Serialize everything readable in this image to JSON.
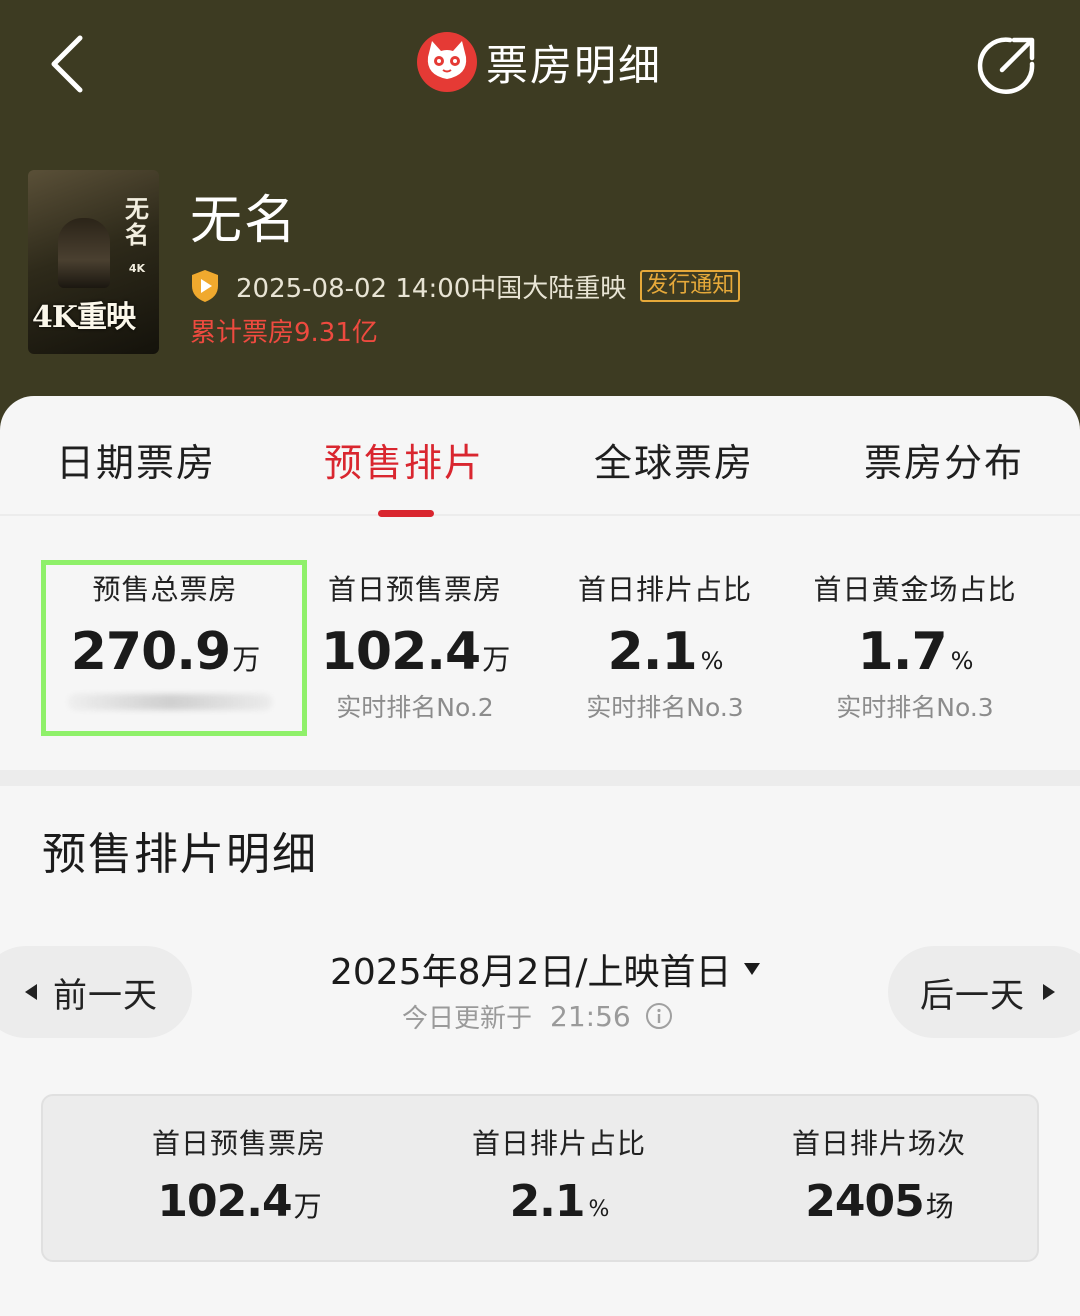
{
  "header": {
    "title": "票房明细",
    "back_icon": "chevron-left-icon",
    "share_icon": "share-icon",
    "logo_icon": "cat-logo-icon"
  },
  "movie": {
    "name": "无名",
    "poster": {
      "calligraphy": "无名",
      "small_label": "4K",
      "tag": "4K重映"
    },
    "release": "2025-08-02 14:00中国大陆重映",
    "notice_badge": "发行通知",
    "cumulative_box_office": "累计票房9.31亿"
  },
  "tabs": [
    {
      "label": "日期票房",
      "active": false
    },
    {
      "label": "预售排片",
      "active": true
    },
    {
      "label": "全球票房",
      "active": false
    },
    {
      "label": "票房分布",
      "active": false
    }
  ],
  "stats": [
    {
      "label": "预售总票房",
      "value": "270.9",
      "unit": "万",
      "rank": ""
    },
    {
      "label": "首日预售票房",
      "value": "102.4",
      "unit": "万",
      "rank": "实时排名No.2"
    },
    {
      "label": "首日排片占比",
      "value": "2.1",
      "unit": "%",
      "rank": "实时排名No.3"
    },
    {
      "label": "首日黄金场占比",
      "value": "1.7",
      "unit": "%",
      "rank": "实时排名No.3"
    }
  ],
  "section": {
    "title": "预售排片明细",
    "prev_day": "前一天",
    "next_day": "后一天",
    "date": "2025年8月2日/上映首日",
    "update_label": "今日更新于",
    "update_time": "21:56"
  },
  "summary": [
    {
      "label": "首日预售票房",
      "value": "102.4",
      "unit": "万"
    },
    {
      "label": "首日排片占比",
      "value": "2.1",
      "unit": "%"
    },
    {
      "label": "首日排片场次",
      "value": "2405",
      "unit": "场"
    }
  ],
  "colors": {
    "header_bg": "#3d3b22",
    "accent_red": "#d9262f",
    "highlight_green": "#8ff06a",
    "badge_orange": "#e6a93a",
    "cumulative_red": "#ee4a3f"
  }
}
